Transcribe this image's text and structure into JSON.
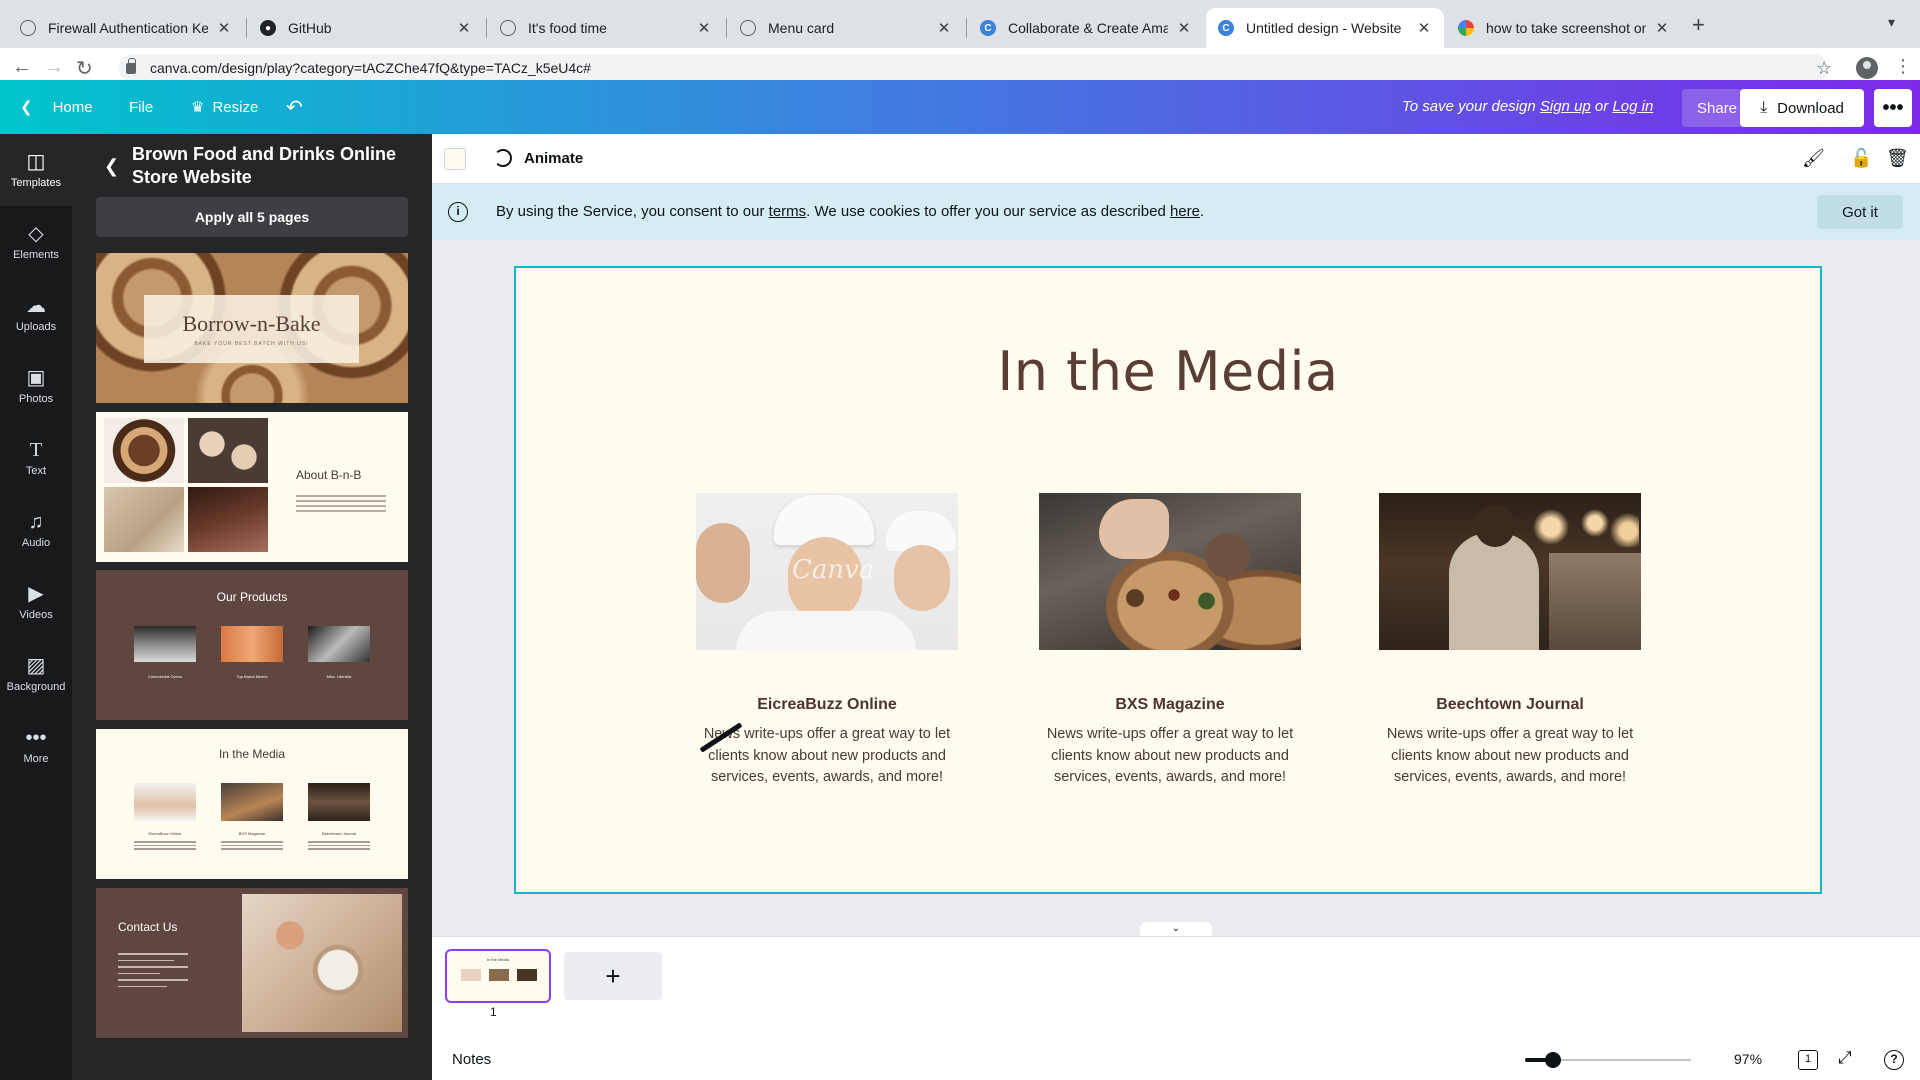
{
  "browser": {
    "tabs": [
      {
        "title": "Firewall Authentication Keepali",
        "icon": "globe-icon"
      },
      {
        "title": "GitHub",
        "icon": "github-icon"
      },
      {
        "title": "It's food time",
        "icon": "globe-icon"
      },
      {
        "title": "Menu card",
        "icon": "globe-icon"
      },
      {
        "title": "Collaborate & Create Amazing",
        "icon": "canva-icon"
      },
      {
        "title": "Untitled design - Website",
        "icon": "canva-icon",
        "active": true
      },
      {
        "title": "how to take screenshot on mac",
        "icon": "google-icon"
      }
    ],
    "close_glyph": "✕",
    "new_tab_glyph": "+",
    "url": "canva.com/design/play?category=tACZChe47fQ&type=TACz_k5eU4c#"
  },
  "header": {
    "home_label": "Home",
    "file_label": "File",
    "resize_label": "Resize",
    "save_prefix": "To save your design ",
    "sign_up": "Sign up",
    "save_or": " or ",
    "log_in": "Log in",
    "share_label": "Share",
    "download_label": "Download",
    "colors": {
      "gradient_start": "#00c4cc",
      "gradient_end": "#7d2ae8"
    }
  },
  "rail": {
    "items": [
      {
        "label": "Templates",
        "icon": "templates-icon",
        "active": true
      },
      {
        "label": "Elements",
        "icon": "elements-icon"
      },
      {
        "label": "Uploads",
        "icon": "uploads-icon"
      },
      {
        "label": "Photos",
        "icon": "photos-icon"
      },
      {
        "label": "Text",
        "icon": "text-icon"
      },
      {
        "label": "Audio",
        "icon": "audio-icon"
      },
      {
        "label": "Videos",
        "icon": "videos-icon"
      },
      {
        "label": "Background",
        "icon": "background-icon"
      },
      {
        "label": "More",
        "icon": "more-icon"
      }
    ]
  },
  "panel": {
    "title": "Brown Food and Drinks Online Store Website",
    "apply_label": "Apply all 5 pages",
    "thumbs": {
      "t1_title": "Borrow-n-Bake",
      "t1_tagline": "BAKE YOUR BEST BATCH WITH US!",
      "t2_title": "About B-n-B",
      "t3_title": "Our Products",
      "t3_captions": [
        "Commercial Ovens",
        "Top Brand Mixers",
        "Misc. Utensils"
      ],
      "t4_title": "In the Media",
      "t4_captions": [
        "EicreaBuzz Online",
        "BXS Magazine",
        "Beechtown Journal"
      ],
      "t5_title": "Contact Us"
    }
  },
  "toolbar": {
    "animate_label": "Animate",
    "page_color": "#fffbee"
  },
  "cookie": {
    "text_before": "By using the Service, you consent to our ",
    "terms_link": "terms",
    "text_middle": ". We use cookies to offer you our service as described ",
    "here_link": "here",
    "text_after": ".",
    "got_it": "Got it"
  },
  "design": {
    "title": "In the Media",
    "watermark": "Canva",
    "cards": [
      {
        "name": "EicreaBuzz Online",
        "desc": "News write-ups offer a great way to let clients know about new products and services, events, awards, and more!"
      },
      {
        "name": "BXS Magazine",
        "desc": "News write-ups offer a great way to let clients know about new products and services, events, awards, and more!"
      },
      {
        "name": "Beechtown Journal",
        "desc": "News write-ups offer a great way to let clients know about new products and services, events, awards, and more!"
      }
    ]
  },
  "pages": {
    "current_page_number": "1",
    "mini_title": "In the Media",
    "add_glyph": "+"
  },
  "footer": {
    "notes_label": "Notes",
    "zoom_percent": "97%",
    "zoom_fraction": 0.97,
    "page_count": "1",
    "help_glyph": "?"
  }
}
